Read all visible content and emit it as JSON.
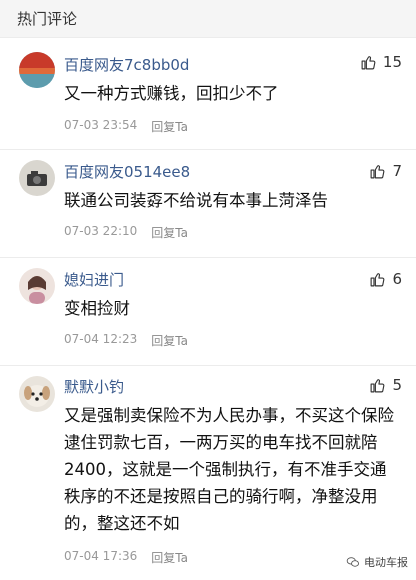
{
  "header": {
    "title": "热门评论"
  },
  "comments": [
    {
      "user": "百度网友7c8bb0d",
      "likes": "15",
      "text": "又一种方式赚钱，回扣少不了",
      "time": "07-03 23:54",
      "reply": "回复Ta"
    },
    {
      "user": "百度网友0514ee8",
      "likes": "7",
      "text": "联通公司装孬不给说有本事上菏泽告",
      "time": "07-03 22:10",
      "reply": "回复Ta"
    },
    {
      "user": "媳妇进门",
      "likes": "6",
      "text": "变相捡财",
      "time": "07-04 12:23",
      "reply": "回复Ta"
    },
    {
      "user": "默默小钓",
      "likes": "5",
      "text": "又是强制卖保险不为人民办事，不买这个保险逮住罚款七百，一两万买的电车找不回就陪2400，这就是一个强制执行，有不准手交通秩序的不还是按照自己的骑行啊，净整没用的，整这还不如",
      "time": "07-04 17:36",
      "reply": "回复Ta"
    }
  ],
  "watermark": {
    "text": "电动车报"
  }
}
